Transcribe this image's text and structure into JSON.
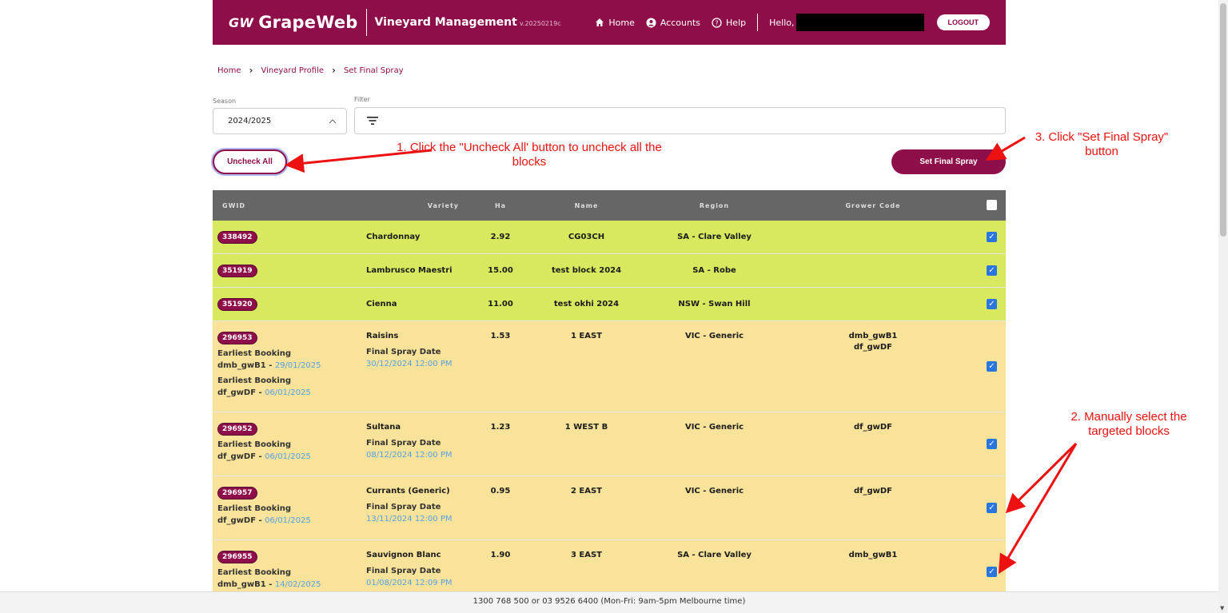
{
  "header": {
    "logo_mark": "GW",
    "logo_text": "GrapeWeb",
    "app_title": "Vineyard Management",
    "version": "v.20250219c",
    "nav": [
      {
        "label": "Home",
        "icon": "home-icon"
      },
      {
        "label": "Accounts",
        "icon": "account-icon"
      },
      {
        "label": "Help",
        "icon": "help-icon"
      }
    ],
    "hello": "Hello,",
    "logout": "LOGOUT",
    "bg_color": "#8e0e4a"
  },
  "breadcrumb": [
    "Home",
    "Vineyard Profile",
    "Set Final Spray"
  ],
  "season": {
    "label": "Season",
    "value": "2024/2025"
  },
  "filter": {
    "label": "Filter"
  },
  "buttons": {
    "uncheck_all": "Uncheck All",
    "set_final_spray": "Set Final Spray"
  },
  "annotations": {
    "step1": "1. Click the \"Uncheck All' button to uncheck all the blocks",
    "step2": "2. Manually select the targeted blocks",
    "step3": "3. Click \"Set Final Spray\" button"
  },
  "table": {
    "headers": [
      "GWID",
      "Variety",
      "Ha",
      "Name",
      "Region",
      "Grower Code"
    ],
    "rows": [
      {
        "gwid": "338492",
        "variety": "Chardonnay",
        "ha": "2.92",
        "name": "CG03CH",
        "region": "SA - Clare Valley",
        "grower": "",
        "checked": true,
        "status": "green"
      },
      {
        "gwid": "351919",
        "variety": "Lambrusco Maestri",
        "ha": "15.00",
        "name": "test block 2024",
        "region": "SA - Robe",
        "grower": "",
        "checked": true,
        "status": "green"
      },
      {
        "gwid": "351920",
        "variety": "Cienna",
        "ha": "11.00",
        "name": "test okhi 2024",
        "region": "NSW - Swan Hill",
        "grower": "",
        "checked": true,
        "status": "green"
      },
      {
        "gwid": "296953",
        "variety": "Raisins",
        "ha": "1.53",
        "name": "1 EAST",
        "region": "VIC - Generic",
        "grower": "dmb_gwB1",
        "grower2": "df_gwDF",
        "final_spray_label": "Final Spray Date",
        "final_spray_date": "30/12/2024 12:00 PM",
        "bookings": [
          {
            "label": "Earliest Booking",
            "code": "dmb_gwB1 - ",
            "date": "29/01/2025"
          },
          {
            "label": "Earliest Booking",
            "code": "df_gwDF - ",
            "date": "06/01/2025"
          }
        ],
        "checked": true,
        "status": "yellow"
      },
      {
        "gwid": "296952",
        "variety": "Sultana",
        "ha": "1.23",
        "name": "1 WEST B",
        "region": "VIC - Generic",
        "grower": "df_gwDF",
        "final_spray_label": "Final Spray Date",
        "final_spray_date": "08/12/2024 12:00 PM",
        "bookings": [
          {
            "label": "Earliest Booking",
            "code": "df_gwDF - ",
            "date": "06/01/2025"
          }
        ],
        "checked": true,
        "status": "yellow"
      },
      {
        "gwid": "296957",
        "variety": "Currants (Generic)",
        "ha": "0.95",
        "name": "2 EAST",
        "region": "VIC - Generic",
        "grower": "df_gwDF",
        "final_spray_label": "Final Spray Date",
        "final_spray_date": "13/11/2024 12:00 PM",
        "bookings": [
          {
            "label": "Earliest Booking",
            "code": "df_gwDF - ",
            "date": "06/01/2025"
          }
        ],
        "checked": true,
        "status": "yellow"
      },
      {
        "gwid": "296955",
        "variety": "Sauvignon Blanc",
        "ha": "1.90",
        "name": "3 EAST",
        "region": "SA - Clare Valley",
        "grower": "dmb_gwB1",
        "final_spray_label": "Final Spray Date",
        "final_spray_date": "01/08/2024 12:09 PM",
        "bookings": [
          {
            "label": "Earliest Booking",
            "code": "dmb_gwB1 - ",
            "date": "14/02/2025"
          }
        ],
        "checked": true,
        "status": "yellow"
      }
    ]
  },
  "footer": "1300 768 500 or 03 9526 6400 (Mon-Fri: 9am-5pm Melbourne time)",
  "colors": {
    "accent": "#8e0e4a",
    "row_green": "#d8e95f",
    "row_yellow": "#f9e29a",
    "annotation": "#ee1111",
    "date_blue": "#5aa0e6"
  }
}
